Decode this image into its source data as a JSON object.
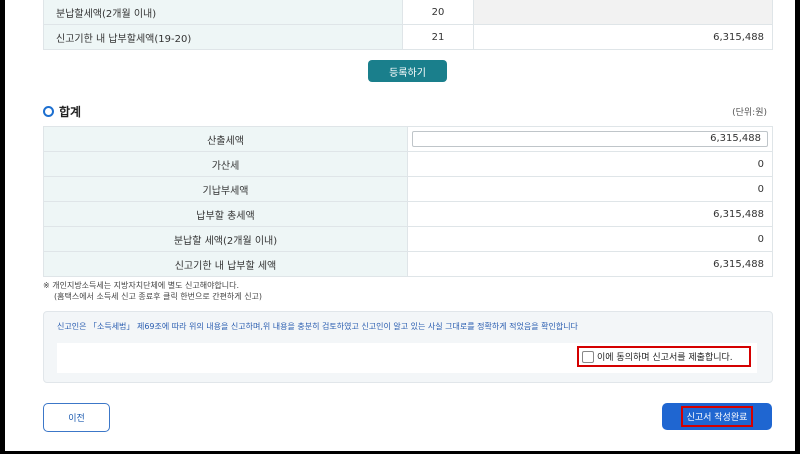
{
  "top_table": {
    "rows": [
      {
        "label": "분납할세액(2개월 이내)",
        "num": "20",
        "value": ""
      },
      {
        "label": "신고기한 내 납부할세액(19-20)",
        "num": "21",
        "value": "6,315,488"
      }
    ]
  },
  "register_button": "등록하기",
  "summary": {
    "title": "합계",
    "unit": "(단위:원)",
    "rows": [
      {
        "label": "산출세액",
        "value": "6,315,488"
      },
      {
        "label": "가산세",
        "value": "0"
      },
      {
        "label": "기납부세액",
        "value": "0"
      },
      {
        "label": "납부할 총세액",
        "value": "6,315,488"
      },
      {
        "label": "분납할 세액(2개월 이내)",
        "value": "0"
      },
      {
        "label": "신고기한 내 납부할 세액",
        "value": "6,315,488"
      }
    ]
  },
  "notes": {
    "line1": "※ 개인지방소득세는 지방자치단체에 별도 신고해야합니다.",
    "line2": "(홈택스에서 소득세 신고 종료후 클릭 한번으로 간편하게 신고)"
  },
  "declaration": {
    "text": "신고인은 「소득세법」 제69조에 따라 위의 내용을 신고하며,위 내용을 충분히 검토하였고 신고인이 알고 있는 사실 그대로를 정확하게 적었음을 확인합니다",
    "agree_label": "이에 동의하며 신고서를 제출합니다."
  },
  "buttons": {
    "prev": "이전",
    "complete": "신고서 작성완료"
  },
  "colors": {
    "accent": "#1a7f8c",
    "primary": "#1f66d1",
    "highlight": "#d40000"
  }
}
